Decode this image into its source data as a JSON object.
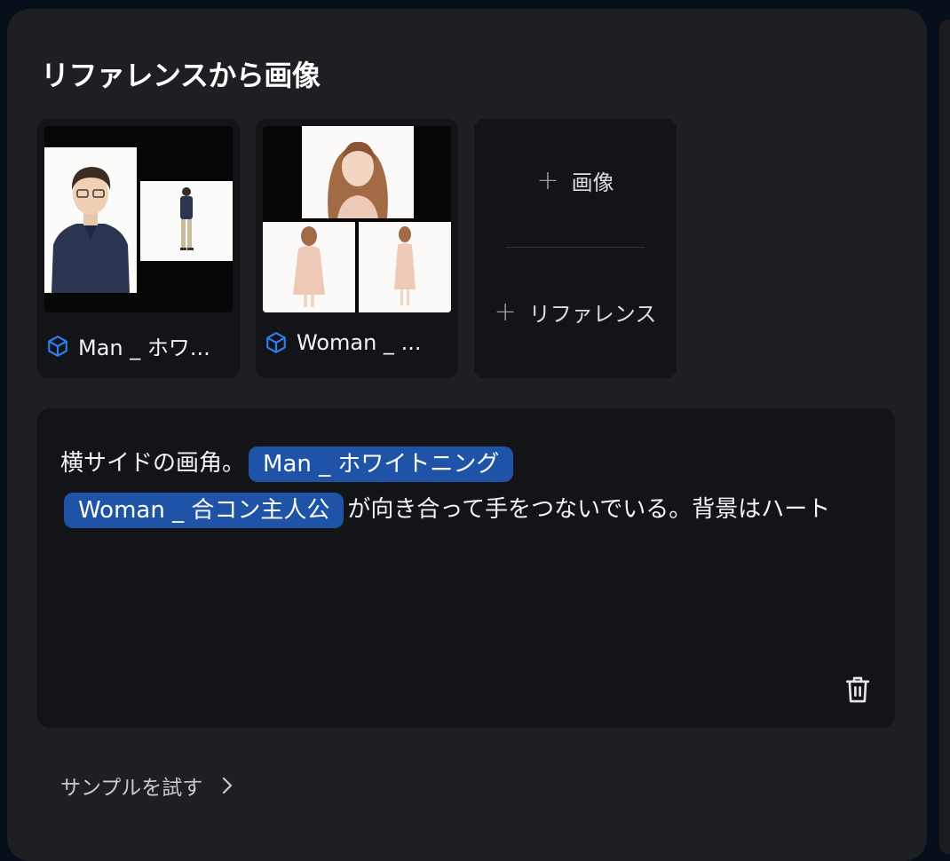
{
  "panel": {
    "title": "リファレンスから画像"
  },
  "references": [
    {
      "name": "Man _ ホワ...",
      "icon": "cube-icon"
    },
    {
      "name": "Woman _ ...",
      "icon": "cube-icon"
    }
  ],
  "add_card": {
    "image_label": "画像",
    "reference_label": "リファレンス"
  },
  "prompt": {
    "text_before": "横サイドの画角。",
    "chip_man": "Man _ ホワイトニング",
    "chip_woman": "Woman _ 合コン主人公",
    "text_after": "が向き合って手をつないでいる。背景はハート",
    "delete_icon": "trash-icon"
  },
  "footer": {
    "sample_label": "サンプルを試す",
    "chevron_icon": "chevron-right-icon"
  },
  "colors": {
    "background": "#07101a",
    "panel": "#1e1f22",
    "card": "#131417",
    "chip": "#1e53a8",
    "accent_icon": "#2f7df0"
  }
}
